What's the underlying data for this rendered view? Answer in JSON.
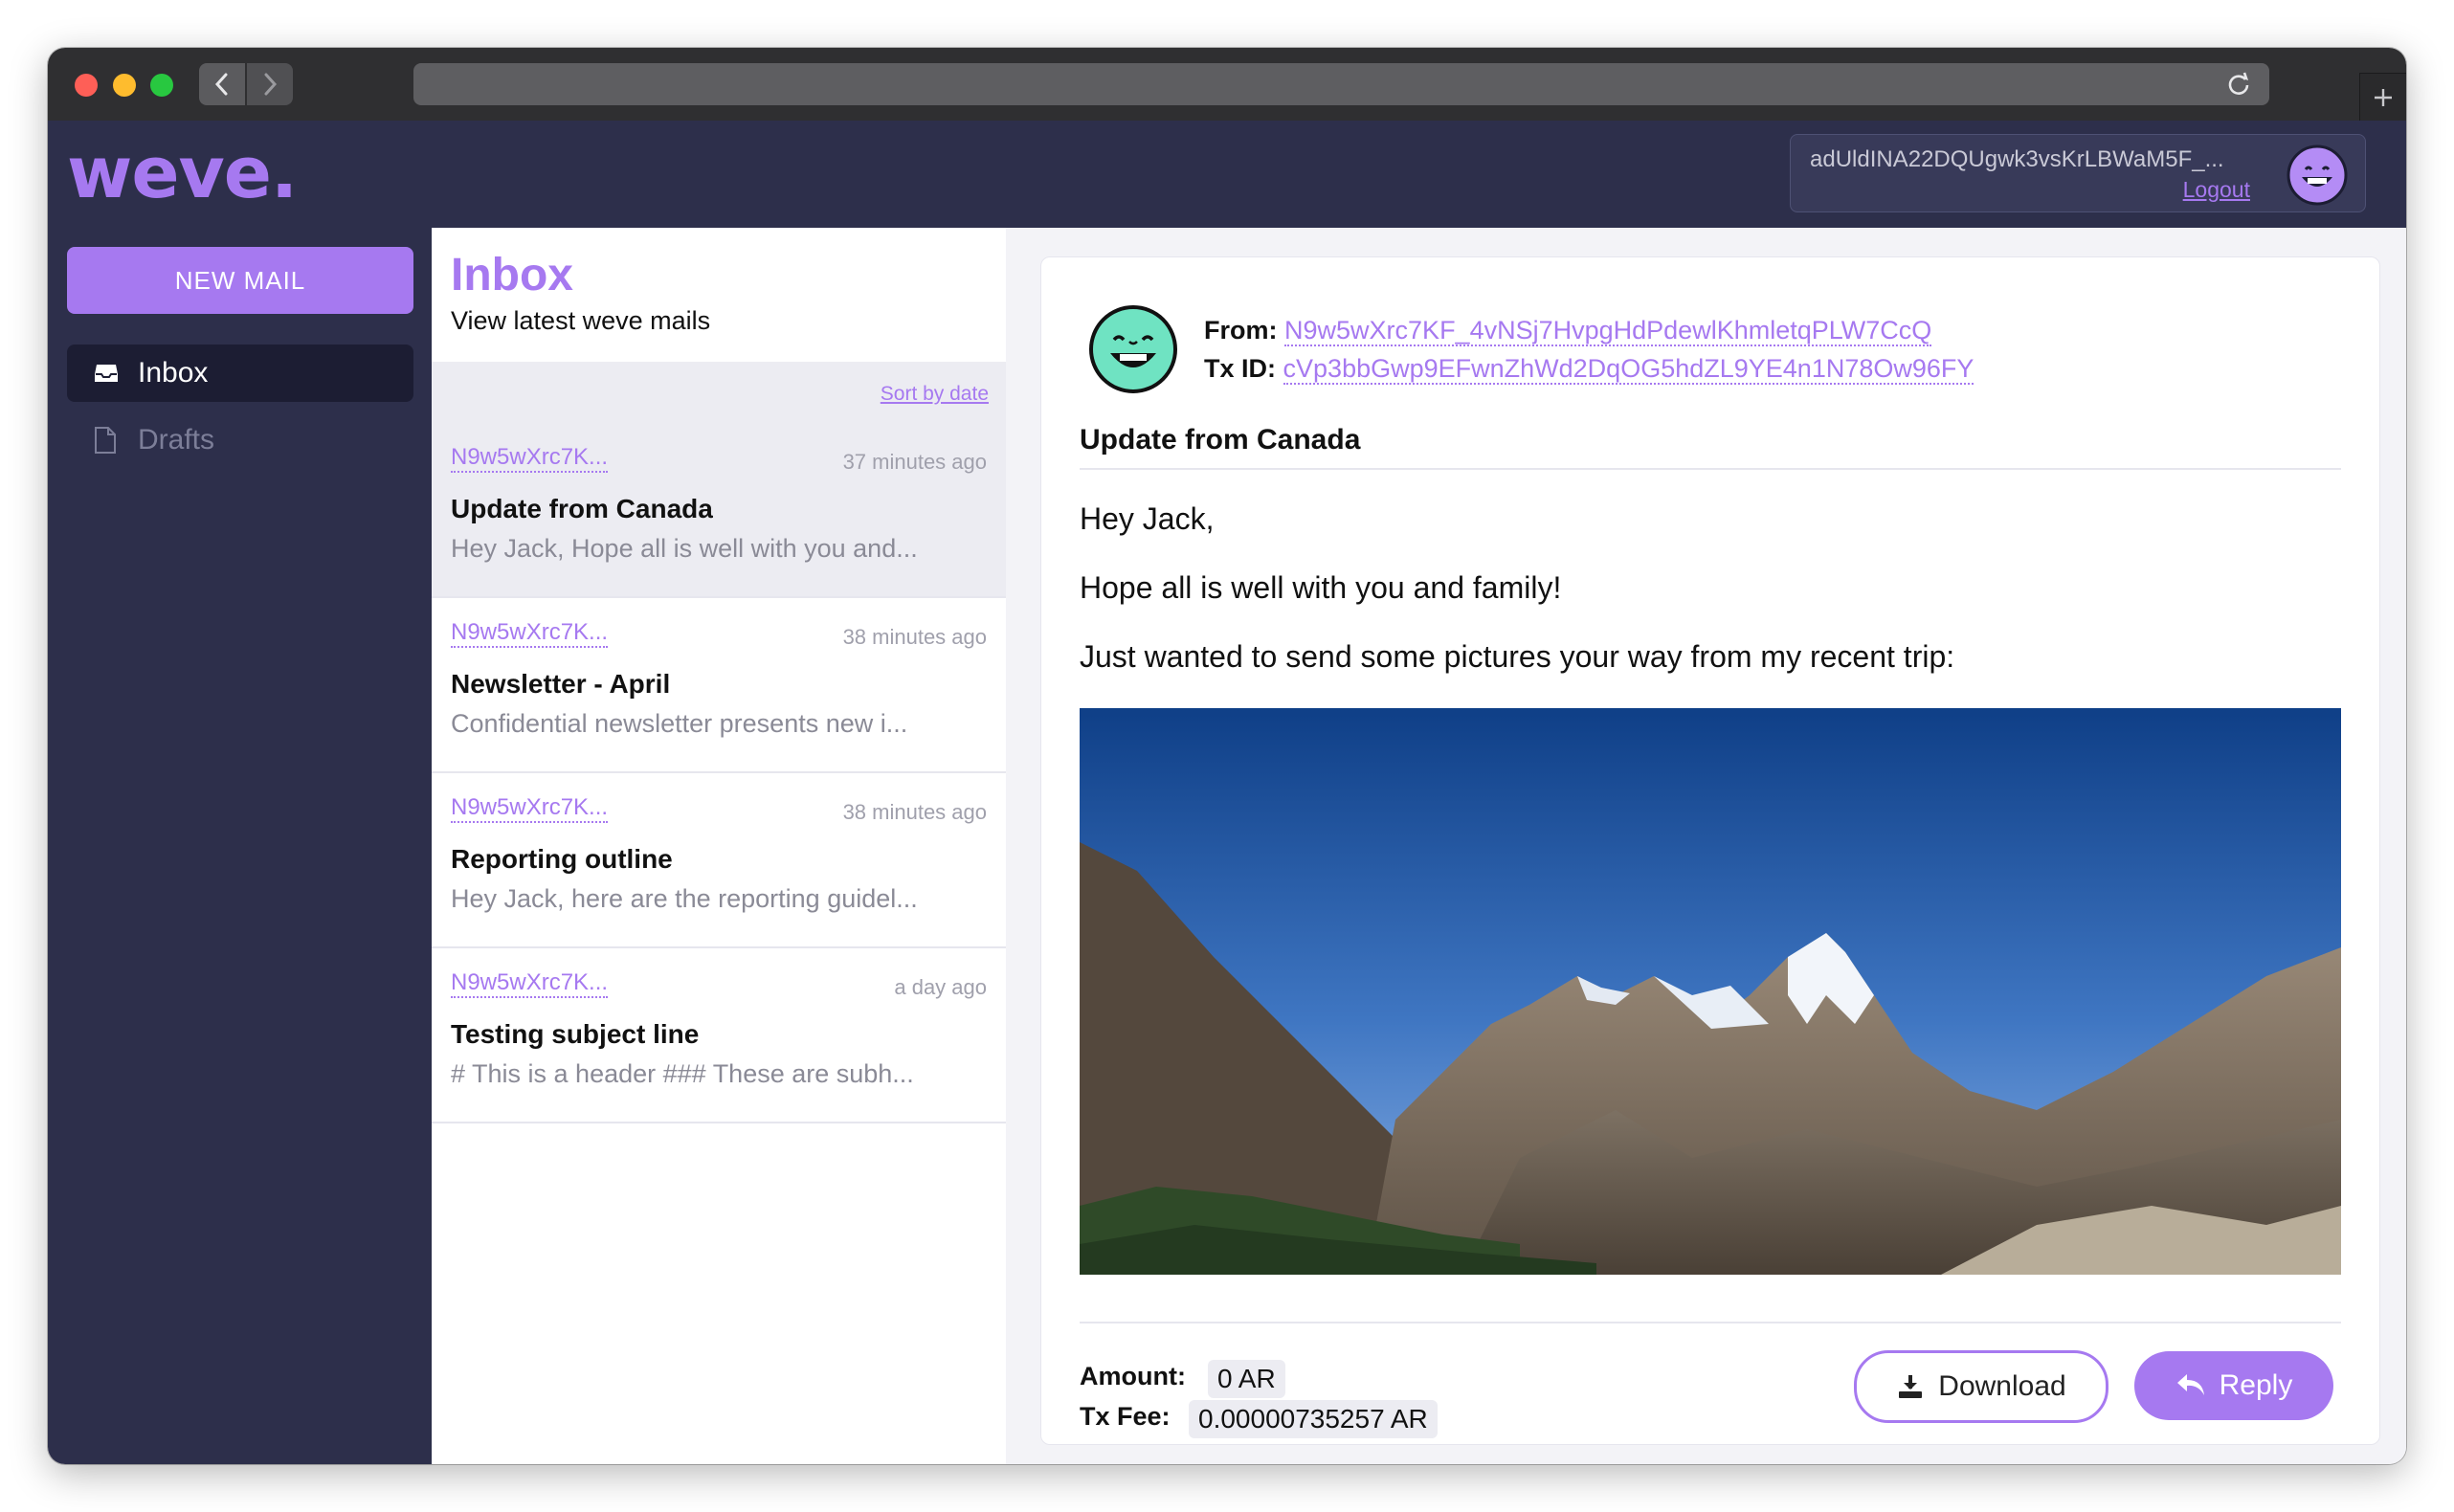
{
  "app": {
    "logo": "weve."
  },
  "user": {
    "address": "adUldINA22DQUgwk3vsKrLBWaM5F_...",
    "logout_label": "Logout"
  },
  "sidebar": {
    "new_mail_label": "NEW MAIL",
    "items": [
      {
        "label": "Inbox",
        "icon": "inbox-icon",
        "active": true
      },
      {
        "label": "Drafts",
        "icon": "document-icon",
        "active": false
      }
    ]
  },
  "inbox": {
    "title": "Inbox",
    "subtitle": "View latest weve mails",
    "sort_label": "Sort by date",
    "mails": [
      {
        "from": "N9w5wXrc7K...",
        "time": "37 minutes ago",
        "subject": "Update from Canada",
        "preview": "Hey Jack, Hope all is well with you and..."
      },
      {
        "from": "N9w5wXrc7K...",
        "time": "38 minutes ago",
        "subject": "Newsletter - April",
        "preview": "Confidential newsletter presents new i..."
      },
      {
        "from": "N9w5wXrc7K...",
        "time": "38 minutes ago",
        "subject": "Reporting outline",
        "preview": "Hey Jack, here are the reporting guidel..."
      },
      {
        "from": "N9w5wXrc7K...",
        "time": "a day ago",
        "subject": "Testing subject line",
        "preview": "# This is a header ### These are subh..."
      }
    ]
  },
  "message": {
    "from_label": "From:",
    "from": "N9w5wXrc7KF_4vNSj7HvpgHdPdewlKhmletqPLW7CcQ",
    "txid_label": "Tx ID:",
    "txid": "cVp3bbGwp9EFwnZhWd2DqOG5hdZL9YE4n1N78Ow96FY",
    "subject": "Update from Canada",
    "greeting": "Hey Jack,",
    "line1": "Hope all is well with you and family!",
    "line2": "Just wanted to send some pictures your way from my recent trip:",
    "amount_label": "Amount:",
    "amount": "0 AR",
    "fee_label": "Tx Fee:",
    "fee": "0.00000735257 AR",
    "download_label": "Download",
    "reply_label": "Reply"
  },
  "colors": {
    "accent": "#a679f0",
    "header_bg": "#2d2f4b",
    "avatar_mint": "#6fe3c2",
    "avatar_purple": "#b48cf5"
  }
}
